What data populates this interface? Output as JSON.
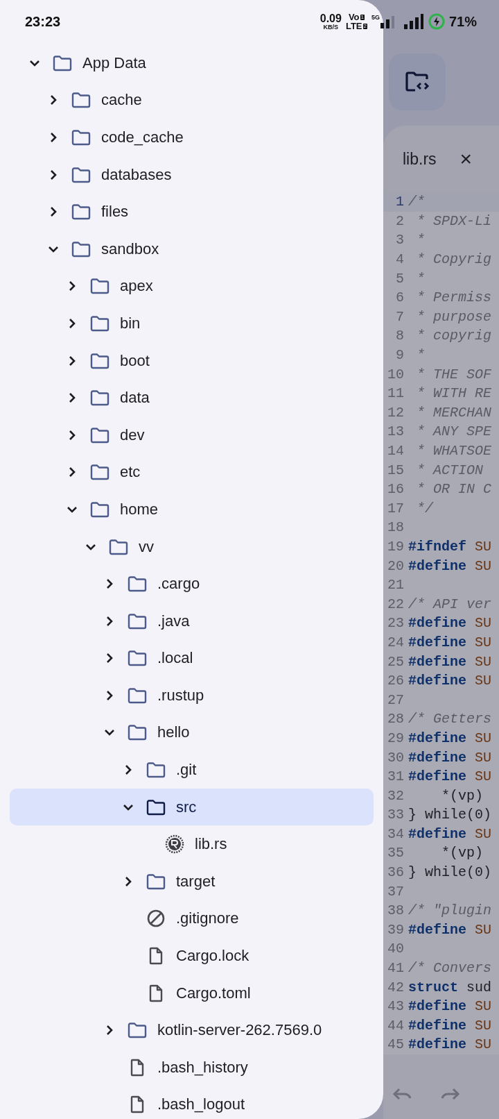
{
  "status_bar": {
    "time": "23:23",
    "speed": "0.09",
    "speed_unit": "KB/S",
    "volte": "Vo",
    "volte_sim": "1",
    "lte": "LTE",
    "lte_sim": "2",
    "network": "5G",
    "battery": "71%"
  },
  "tree": [
    {
      "label": "App Data",
      "kind": "folder",
      "expanded": true,
      "selected": false,
      "children": [
        {
          "label": "cache",
          "kind": "folder",
          "expanded": false,
          "selected": false
        },
        {
          "label": "code_cache",
          "kind": "folder",
          "expanded": false,
          "selected": false
        },
        {
          "label": "databases",
          "kind": "folder",
          "expanded": false,
          "selected": false
        },
        {
          "label": "files",
          "kind": "folder",
          "expanded": false,
          "selected": false
        },
        {
          "label": "sandbox",
          "kind": "folder",
          "expanded": true,
          "selected": false,
          "children": [
            {
              "label": "apex",
              "kind": "folder",
              "expanded": false,
              "selected": false
            },
            {
              "label": "bin",
              "kind": "folder",
              "expanded": false,
              "selected": false
            },
            {
              "label": "boot",
              "kind": "folder",
              "expanded": false,
              "selected": false
            },
            {
              "label": "data",
              "kind": "folder",
              "expanded": false,
              "selected": false
            },
            {
              "label": "dev",
              "kind": "folder",
              "expanded": false,
              "selected": false
            },
            {
              "label": "etc",
              "kind": "folder",
              "expanded": false,
              "selected": false
            },
            {
              "label": "home",
              "kind": "folder",
              "expanded": true,
              "selected": false,
              "children": [
                {
                  "label": "vv",
                  "kind": "folder",
                  "expanded": true,
                  "selected": false,
                  "children": [
                    {
                      "label": ".cargo",
                      "kind": "folder",
                      "expanded": false,
                      "selected": false
                    },
                    {
                      "label": ".java",
                      "kind": "folder",
                      "expanded": false,
                      "selected": false
                    },
                    {
                      "label": ".local",
                      "kind": "folder",
                      "expanded": false,
                      "selected": false
                    },
                    {
                      "label": ".rustup",
                      "kind": "folder",
                      "expanded": false,
                      "selected": false
                    },
                    {
                      "label": "hello",
                      "kind": "folder",
                      "expanded": true,
                      "selected": false,
                      "children": [
                        {
                          "label": ".git",
                          "kind": "folder",
                          "expanded": false,
                          "selected": false
                        },
                        {
                          "label": "src",
                          "kind": "folder",
                          "expanded": true,
                          "selected": true,
                          "children": [
                            {
                              "label": "lib.rs",
                              "kind": "rust",
                              "selected": false
                            }
                          ]
                        },
                        {
                          "label": "target",
                          "kind": "folder",
                          "expanded": false,
                          "selected": false
                        },
                        {
                          "label": ".gitignore",
                          "kind": "ignore",
                          "selected": false
                        },
                        {
                          "label": "Cargo.lock",
                          "kind": "file",
                          "selected": false
                        },
                        {
                          "label": "Cargo.toml",
                          "kind": "file",
                          "selected": false
                        }
                      ]
                    },
                    {
                      "label": "kotlin-server-262.7569.0",
                      "kind": "folder",
                      "expanded": false,
                      "selected": false
                    },
                    {
                      "label": ".bash_history",
                      "kind": "file",
                      "selected": false
                    },
                    {
                      "label": ".bash_logout",
                      "kind": "file",
                      "selected": false
                    }
                  ]
                }
              ]
            }
          ]
        }
      ]
    }
  ],
  "editor": {
    "tabs": [
      {
        "label": "lib.rs",
        "selected": true,
        "close": "×"
      }
    ],
    "lines": [
      {
        "number": "1",
        "current": true,
        "tokens": [
          {
            "kind": "comment",
            "text": "/*"
          }
        ]
      },
      {
        "number": "2",
        "current": false,
        "tokens": [
          {
            "kind": "comment",
            "text": " * SPDX-Li"
          }
        ]
      },
      {
        "number": "3",
        "current": false,
        "tokens": [
          {
            "kind": "comment",
            "text": " *"
          }
        ]
      },
      {
        "number": "4",
        "current": false,
        "tokens": [
          {
            "kind": "comment",
            "text": " * Copyrig"
          }
        ]
      },
      {
        "number": "5",
        "current": false,
        "tokens": [
          {
            "kind": "comment",
            "text": " *"
          }
        ]
      },
      {
        "number": "6",
        "current": false,
        "tokens": [
          {
            "kind": "comment",
            "text": " * Permiss"
          }
        ]
      },
      {
        "number": "7",
        "current": false,
        "tokens": [
          {
            "kind": "comment",
            "text": " * purpose"
          }
        ]
      },
      {
        "number": "8",
        "current": false,
        "tokens": [
          {
            "kind": "comment",
            "text": " * copyrig"
          }
        ]
      },
      {
        "number": "9",
        "current": false,
        "tokens": [
          {
            "kind": "comment",
            "text": " *"
          }
        ]
      },
      {
        "number": "10",
        "current": false,
        "tokens": [
          {
            "kind": "comment",
            "text": " * THE SOF"
          }
        ]
      },
      {
        "number": "11",
        "current": false,
        "tokens": [
          {
            "kind": "comment",
            "text": " * WITH RE"
          }
        ]
      },
      {
        "number": "12",
        "current": false,
        "tokens": [
          {
            "kind": "comment",
            "text": " * MERCHAN"
          }
        ]
      },
      {
        "number": "13",
        "current": false,
        "tokens": [
          {
            "kind": "comment",
            "text": " * ANY SPE"
          }
        ]
      },
      {
        "number": "14",
        "current": false,
        "tokens": [
          {
            "kind": "comment",
            "text": " * WHATSOE"
          }
        ]
      },
      {
        "number": "15",
        "current": false,
        "tokens": [
          {
            "kind": "comment",
            "text": " * ACTION"
          }
        ]
      },
      {
        "number": "16",
        "current": false,
        "tokens": [
          {
            "kind": "comment",
            "text": " * OR IN C"
          }
        ]
      },
      {
        "number": "17",
        "current": false,
        "tokens": [
          {
            "kind": "comment",
            "text": " */"
          }
        ]
      },
      {
        "number": "18",
        "current": false
      },
      {
        "number": "19",
        "current": false,
        "tokens": [
          {
            "kind": "directive",
            "text": "#ifndef"
          },
          {
            "kind": "macro",
            "text": " SU"
          }
        ]
      },
      {
        "number": "20",
        "current": false,
        "tokens": [
          {
            "kind": "directive",
            "text": "#define"
          },
          {
            "kind": "macro",
            "text": " SU"
          }
        ]
      },
      {
        "number": "21",
        "current": false
      },
      {
        "number": "22",
        "current": false,
        "tokens": [
          {
            "kind": "comment",
            "text": "/* API ver"
          }
        ]
      },
      {
        "number": "23",
        "current": false,
        "tokens": [
          {
            "kind": "directive",
            "text": "#define"
          },
          {
            "kind": "macro",
            "text": " SU"
          }
        ]
      },
      {
        "number": "24",
        "current": false,
        "tokens": [
          {
            "kind": "directive",
            "text": "#define"
          },
          {
            "kind": "macro",
            "text": " SU"
          }
        ]
      },
      {
        "number": "25",
        "current": false,
        "tokens": [
          {
            "kind": "directive",
            "text": "#define"
          },
          {
            "kind": "macro",
            "text": " SU"
          }
        ]
      },
      {
        "number": "26",
        "current": false,
        "tokens": [
          {
            "kind": "directive",
            "text": "#define"
          },
          {
            "kind": "macro",
            "text": " SU"
          }
        ]
      },
      {
        "number": "27",
        "current": false
      },
      {
        "number": "28",
        "current": false,
        "tokens": [
          {
            "kind": "comment",
            "text": "/* Getters"
          }
        ]
      },
      {
        "number": "29",
        "current": false,
        "tokens": [
          {
            "kind": "directive",
            "text": "#define"
          },
          {
            "kind": "macro",
            "text": " SU"
          }
        ]
      },
      {
        "number": "30",
        "current": false,
        "tokens": [
          {
            "kind": "directive",
            "text": "#define"
          },
          {
            "kind": "macro",
            "text": " SU"
          }
        ]
      },
      {
        "number": "31",
        "current": false,
        "tokens": [
          {
            "kind": "directive",
            "text": "#define"
          },
          {
            "kind": "macro",
            "text": " SU"
          }
        ]
      },
      {
        "number": "32",
        "current": false,
        "tokens": [
          {
            "kind": "plain",
            "text": "    *(vp)"
          }
        ]
      },
      {
        "number": "33",
        "current": false,
        "tokens": [
          {
            "kind": "plain",
            "text": "} while(0)"
          }
        ]
      },
      {
        "number": "34",
        "current": false,
        "tokens": [
          {
            "kind": "directive",
            "text": "#define"
          },
          {
            "kind": "macro",
            "text": " SU"
          }
        ]
      },
      {
        "number": "35",
        "current": false,
        "tokens": [
          {
            "kind": "plain",
            "text": "    *(vp)"
          }
        ]
      },
      {
        "number": "36",
        "current": false,
        "tokens": [
          {
            "kind": "plain",
            "text": "} while(0)"
          }
        ]
      },
      {
        "number": "37",
        "current": false
      },
      {
        "number": "38",
        "current": false,
        "tokens": [
          {
            "kind": "comment",
            "text": "/* \"plugin"
          }
        ]
      },
      {
        "number": "39",
        "current": false,
        "tokens": [
          {
            "kind": "directive",
            "text": "#define"
          },
          {
            "kind": "macro",
            "text": " SU"
          }
        ]
      },
      {
        "number": "40",
        "current": false
      },
      {
        "number": "41",
        "current": false,
        "tokens": [
          {
            "kind": "comment",
            "text": "/* Convers"
          }
        ]
      },
      {
        "number": "42",
        "current": false,
        "tokens": [
          {
            "kind": "keyword",
            "text": "struct"
          },
          {
            "kind": "plain",
            "text": " sud"
          }
        ]
      },
      {
        "number": "43",
        "current": false,
        "tokens": [
          {
            "kind": "directive",
            "text": "#define"
          },
          {
            "kind": "macro",
            "text": " SU"
          }
        ]
      },
      {
        "number": "44",
        "current": false,
        "tokens": [
          {
            "kind": "directive",
            "text": "#define"
          },
          {
            "kind": "macro",
            "text": " SU"
          }
        ]
      },
      {
        "number": "45",
        "current": false,
        "tokens": [
          {
            "kind": "directive",
            "text": "#define"
          },
          {
            "kind": "macro",
            "text": " SU"
          }
        ]
      }
    ]
  }
}
